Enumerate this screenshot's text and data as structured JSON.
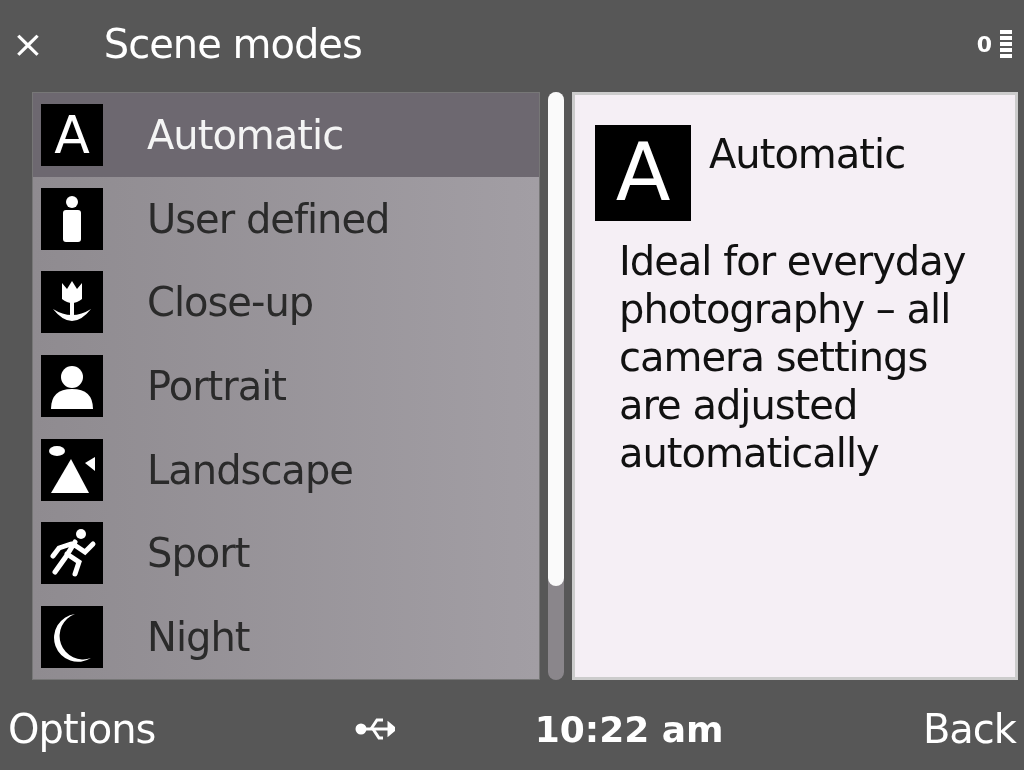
{
  "header": {
    "close": "×",
    "title": "Scene modes",
    "indicator": "0"
  },
  "modes": [
    {
      "kind": "letter",
      "glyph": "A",
      "label": "Automatic",
      "selected": true
    },
    {
      "kind": "user",
      "label": "User defined",
      "selected": false
    },
    {
      "kind": "closeup",
      "label": "Close-up",
      "selected": false
    },
    {
      "kind": "portrait",
      "label": "Portrait",
      "selected": false
    },
    {
      "kind": "landscape",
      "label": "Landscape",
      "selected": false
    },
    {
      "kind": "sport",
      "label": "Sport",
      "selected": false
    },
    {
      "kind": "night",
      "label": "Night",
      "selected": false
    }
  ],
  "preview": {
    "kind": "letter",
    "glyph": "A",
    "title": "Automatic",
    "description": "Ideal for everyday photography – all camera settings are adjusted automatically"
  },
  "softkeys": {
    "left": "Options",
    "time": "10:22 am",
    "right": "Back"
  }
}
